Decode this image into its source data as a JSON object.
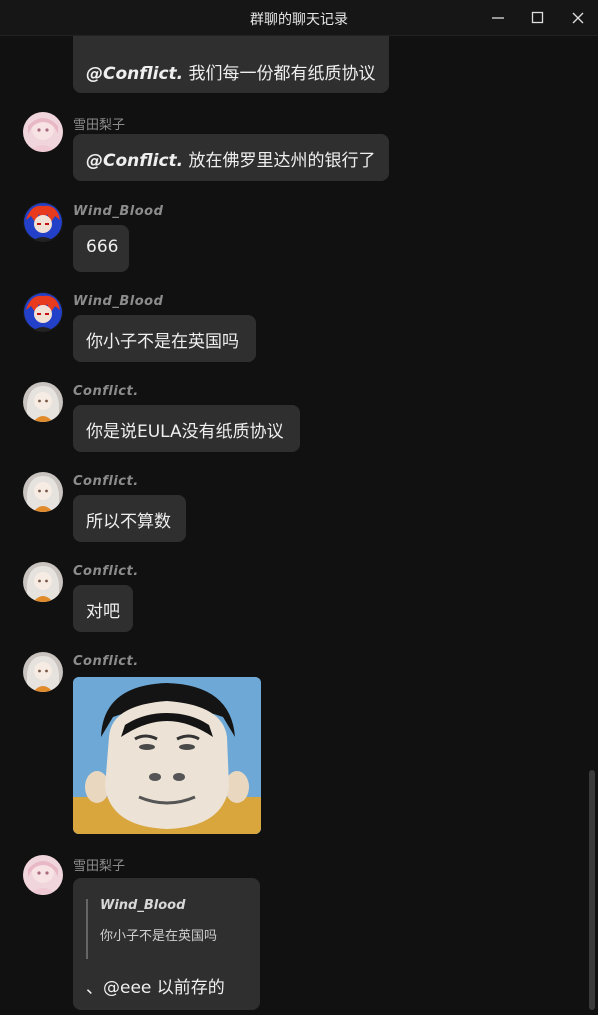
{
  "window": {
    "title": "群聊的聊天记录",
    "buttons": {
      "minimize": "minimize-icon",
      "maximize": "maximize-icon",
      "close": "close-icon"
    }
  },
  "messages": [
    {
      "sender": "",
      "text_mention": "@Conflict.",
      "text_body": " 我们每一份都有纸质协议"
    },
    {
      "sender": "雪田梨子",
      "text_mention": "@Conflict.",
      "text_body": " 放在佛罗里达州的银行了"
    },
    {
      "sender": "Wind_Blood",
      "text": "666"
    },
    {
      "sender": "Wind_Blood",
      "text": "你小子不是在英国吗"
    },
    {
      "sender": "Conflict.",
      "text": "你是说EULA没有纸质协议"
    },
    {
      "sender": "Conflict.",
      "text": "所以不算数"
    },
    {
      "sender": "Conflict.",
      "text": "对吧"
    },
    {
      "sender": "Conflict.",
      "image": "meme-face-image"
    },
    {
      "sender": "雪田梨子",
      "quote_name": "Wind_Blood",
      "quote_text": "你小子不是在英国吗",
      "text": "、@eee 以前存的"
    }
  ]
}
